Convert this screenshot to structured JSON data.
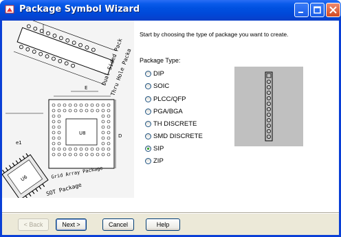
{
  "window": {
    "title": "Package Symbol Wizard"
  },
  "intro_text": "Start by choosing the type of package you want to create.",
  "package_type": {
    "label": "Package Type:",
    "options": [
      "DIP",
      "SOIC",
      "PLCC/QFP",
      "PGA/BGA",
      "TH DISCRETE",
      "SMD DISCRETE",
      "SIP",
      "ZIP"
    ],
    "selected": "SIP"
  },
  "buttons": {
    "back": "< Back",
    "next": "Next >",
    "cancel": "Cancel",
    "help": "Help"
  },
  "art_text": [
    "Grid Array Package",
    "Hole Package",
    "Dual Sided",
    "SOT Package",
    "PLCC",
    "U8"
  ],
  "colors": {
    "titlebar": "#0a5bea",
    "selected_radio": "#21a121",
    "preview_bg": "#c0c0c0"
  }
}
